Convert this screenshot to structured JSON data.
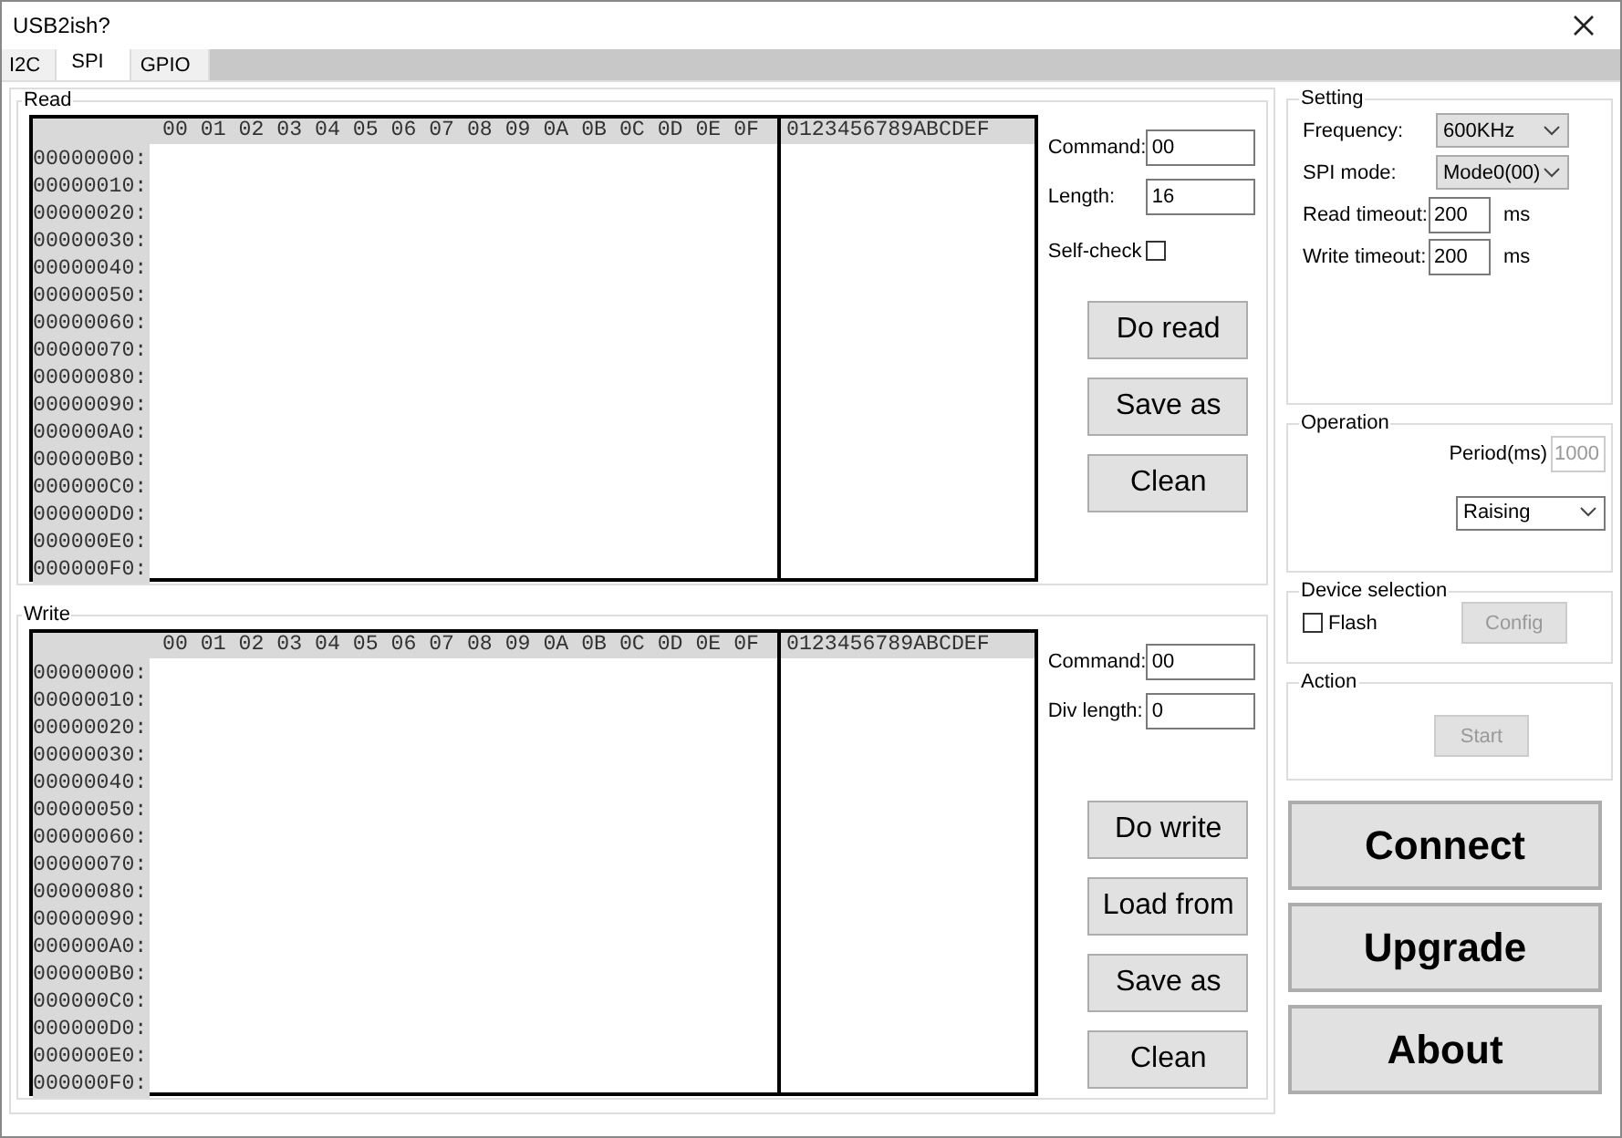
{
  "window": {
    "title": "USB2ish?"
  },
  "tabs": [
    {
      "label": "I2C",
      "selected": false
    },
    {
      "label": "SPI",
      "selected": true
    },
    {
      "label": "GPIO",
      "selected": false
    }
  ],
  "read": {
    "title": "Read",
    "hex_header": "00 01 02 03 04 05 06 07 08 09 0A 0B 0C 0D 0E 0F",
    "ascii_header": "0123456789ABCDEF",
    "addresses": [
      "00000000:",
      "00000010:",
      "00000020:",
      "00000030:",
      "00000040:",
      "00000050:",
      "00000060:",
      "00000070:",
      "00000080:",
      "00000090:",
      "000000A0:",
      "000000B0:",
      "000000C0:",
      "000000D0:",
      "000000E0:",
      "000000F0:"
    ],
    "fields": [
      {
        "label": "Command:",
        "value": "00"
      },
      {
        "label": "Length:",
        "value": "16"
      }
    ],
    "self_check": {
      "label": "Self-check",
      "checked": false
    },
    "buttons": [
      "Do read",
      "Save as",
      "Clean"
    ]
  },
  "write": {
    "title": "Write",
    "hex_header": "00 01 02 03 04 05 06 07 08 09 0A 0B 0C 0D 0E 0F",
    "ascii_header": "0123456789ABCDEF",
    "addresses": [
      "00000000:",
      "00000010:",
      "00000020:",
      "00000030:",
      "00000040:",
      "00000050:",
      "00000060:",
      "00000070:",
      "00000080:",
      "00000090:",
      "000000A0:",
      "000000B0:",
      "000000C0:",
      "000000D0:",
      "000000E0:",
      "000000F0:"
    ],
    "fields": [
      {
        "label": "Command:",
        "value": "00"
      },
      {
        "label": "Div length:",
        "value": "0"
      }
    ],
    "buttons": [
      "Do write",
      "Load from",
      "Save as",
      "Clean"
    ]
  },
  "setting": {
    "title": "Setting",
    "dropdowns": [
      {
        "label": "Frequency:",
        "value": "600KHz"
      },
      {
        "label": "SPI mode:",
        "value": "Mode0(00)"
      }
    ],
    "timeouts": [
      {
        "label": "Read timeout:",
        "value": "200",
        "unit": "ms"
      },
      {
        "label": "Write timeout:",
        "value": "200",
        "unit": "ms"
      }
    ]
  },
  "operation": {
    "title": "Operation",
    "period": {
      "label": "Period(ms)",
      "value": "1000",
      "disabled": true
    },
    "edge": {
      "value": "Raising"
    }
  },
  "device_selection": {
    "title": "Device selection",
    "flash": {
      "label": "Flash",
      "checked": false
    },
    "config_button": {
      "label": "Config",
      "disabled": true
    }
  },
  "action": {
    "title": "Action",
    "start_button": {
      "label": "Start",
      "disabled": true
    }
  },
  "main_buttons": [
    "Connect",
    "Upgrade",
    "About"
  ]
}
